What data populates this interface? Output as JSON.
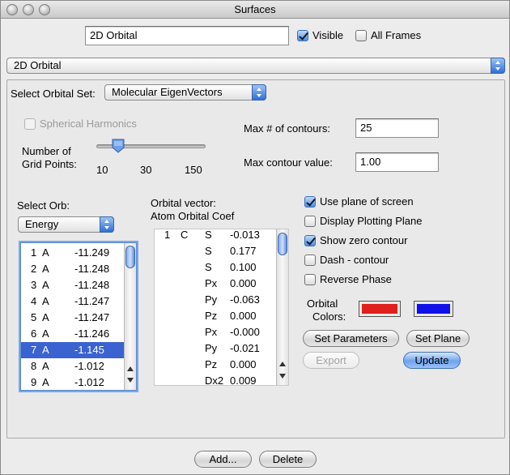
{
  "window": {
    "title": "Surfaces"
  },
  "header": {
    "name_value": "2D Orbital",
    "visible_label": "Visible",
    "visible_checked": true,
    "all_frames_label": "All Frames",
    "all_frames_checked": false
  },
  "surface_type": {
    "selected": "2D Orbital"
  },
  "orbital_set": {
    "label": "Select Orbital Set:",
    "selected": "Molecular EigenVectors"
  },
  "spherical_harmonics": {
    "label": "Spherical Harmonics",
    "checked": false,
    "enabled": false
  },
  "grid": {
    "label_line1": "Number of",
    "label_line2": "Grid Points:",
    "ticks": [
      "10",
      "30",
      "150"
    ],
    "value_fraction": 0.2
  },
  "contours": {
    "max_count_label": "Max # of contours:",
    "max_count_value": "25",
    "max_value_label": "Max contour value:",
    "max_value_value": "1.00"
  },
  "orb_select": {
    "label": "Select Orb:",
    "sort_selected": "Energy",
    "rows": [
      {
        "num": "1",
        "sym": "A",
        "energy": "-11.249"
      },
      {
        "num": "2",
        "sym": "A",
        "energy": "-11.248"
      },
      {
        "num": "3",
        "sym": "A",
        "energy": "-11.248"
      },
      {
        "num": "4",
        "sym": "A",
        "energy": "-11.247"
      },
      {
        "num": "5",
        "sym": "A",
        "energy": "-11.247"
      },
      {
        "num": "6",
        "sym": "A",
        "energy": "-11.246"
      },
      {
        "num": "7",
        "sym": "A",
        "energy": "-1.145"
      },
      {
        "num": "8",
        "sym": "A",
        "energy": "-1.012"
      },
      {
        "num": "9",
        "sym": "A",
        "energy": "-1.012"
      }
    ],
    "selected_index": 6
  },
  "orbital_vector": {
    "title_line1": "Orbital vector:",
    "title_line2": "Atom Orbital Coef",
    "rows": [
      {
        "atom_num": "1",
        "atom": "C",
        "orb": "S",
        "coef": "-0.013"
      },
      {
        "atom_num": "",
        "atom": "",
        "orb": "S",
        "coef": "0.177"
      },
      {
        "atom_num": "",
        "atom": "",
        "orb": "S",
        "coef": "0.100"
      },
      {
        "atom_num": "",
        "atom": "",
        "orb": "Px",
        "coef": "0.000"
      },
      {
        "atom_num": "",
        "atom": "",
        "orb": "Py",
        "coef": "-0.063"
      },
      {
        "atom_num": "",
        "atom": "",
        "orb": "Pz",
        "coef": "0.000"
      },
      {
        "atom_num": "",
        "atom": "",
        "orb": "Px",
        "coef": "-0.000"
      },
      {
        "atom_num": "",
        "atom": "",
        "orb": "Py",
        "coef": "-0.021"
      },
      {
        "atom_num": "",
        "atom": "",
        "orb": "Pz",
        "coef": "0.000"
      },
      {
        "atom_num": "",
        "atom": "",
        "orb": "Dx2",
        "coef": "0.009"
      }
    ]
  },
  "options": [
    {
      "label": "Use plane of screen",
      "checked": true
    },
    {
      "label": "Display Plotting Plane",
      "checked": false
    },
    {
      "label": "Show zero contour",
      "checked": true
    },
    {
      "label": "Dash - contour",
      "checked": false
    },
    {
      "label": "Reverse Phase",
      "checked": false
    }
  ],
  "colors": {
    "label_line1": "Orbital",
    "label_line2": "Colors:",
    "positive": "#e0201c",
    "negative": "#1010e8"
  },
  "buttons": {
    "set_parameters": "Set Parameters",
    "set_plane": "Set Plane",
    "export": "Export",
    "update": "Update",
    "add": "Add...",
    "delete": "Delete"
  }
}
